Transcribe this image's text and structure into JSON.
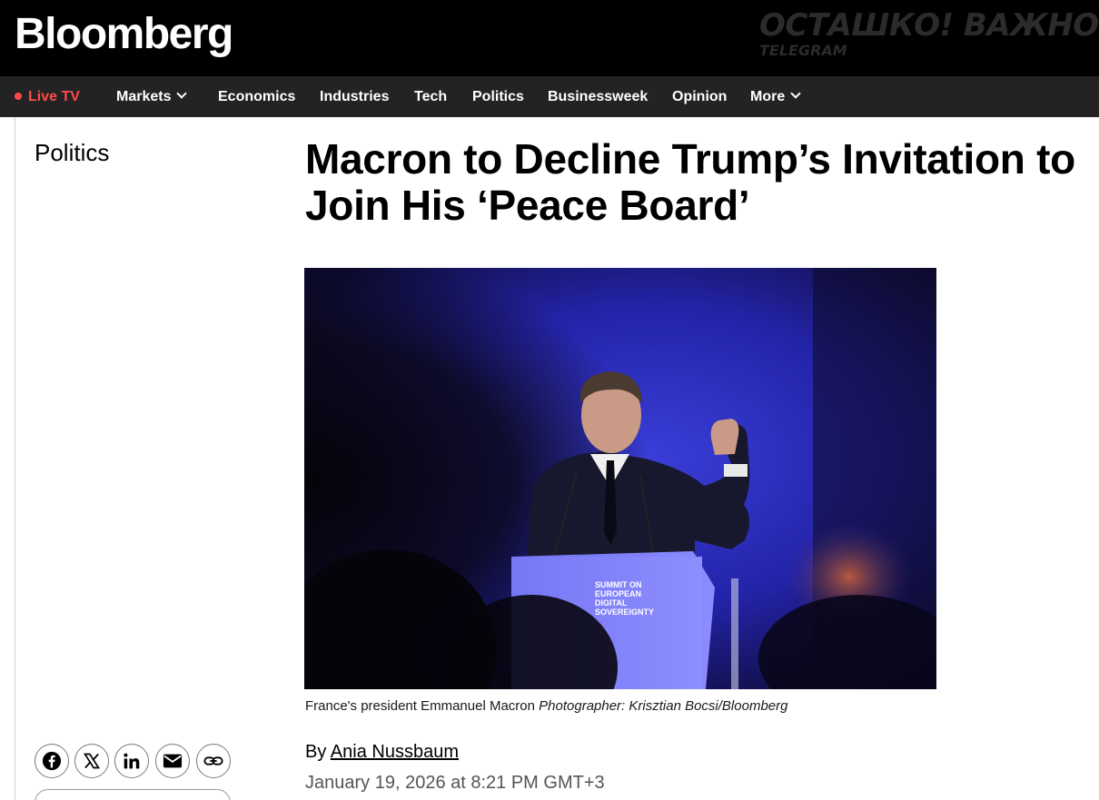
{
  "header": {
    "logo_text": "Bloomberg",
    "watermark": {
      "main": "ОСТАШКО! ВАЖНОЕ",
      "sub": "TELEGRAM"
    }
  },
  "nav": {
    "live_label": "Live TV",
    "items": [
      {
        "label": "Markets",
        "has_dropdown": true
      },
      {
        "label": "Economics"
      },
      {
        "label": "Industries"
      },
      {
        "label": "Tech"
      },
      {
        "label": "Politics"
      },
      {
        "label": "Businessweek"
      },
      {
        "label": "Opinion"
      },
      {
        "label": "More",
        "has_dropdown": true
      }
    ]
  },
  "article": {
    "section": "Politics",
    "headline": "Macron to Decline Trump’s Invitation to Join His ‘Peace Board’",
    "image": {
      "caption": "France's president Emmanuel Macron",
      "credit": "Photographer: Krisztian Bocsi/Bloomberg",
      "podium_text": [
        "SUMMIT ON",
        "EUROPEAN",
        "DIGITAL",
        "SOVEREIGNTY"
      ]
    },
    "byline_prefix": "By",
    "author": "Ania Nussbaum",
    "date": "January 19, 2026 at 8:21 PM GMT+3"
  },
  "share": {
    "icons": [
      "facebook-icon",
      "x-icon",
      "linkedin-icon",
      "email-icon",
      "link-icon"
    ]
  },
  "colors": {
    "brandbar": "#000000",
    "navbar": "#232323",
    "live": "#ff4a4a",
    "photo_backdrop": "#2a2ab8"
  }
}
